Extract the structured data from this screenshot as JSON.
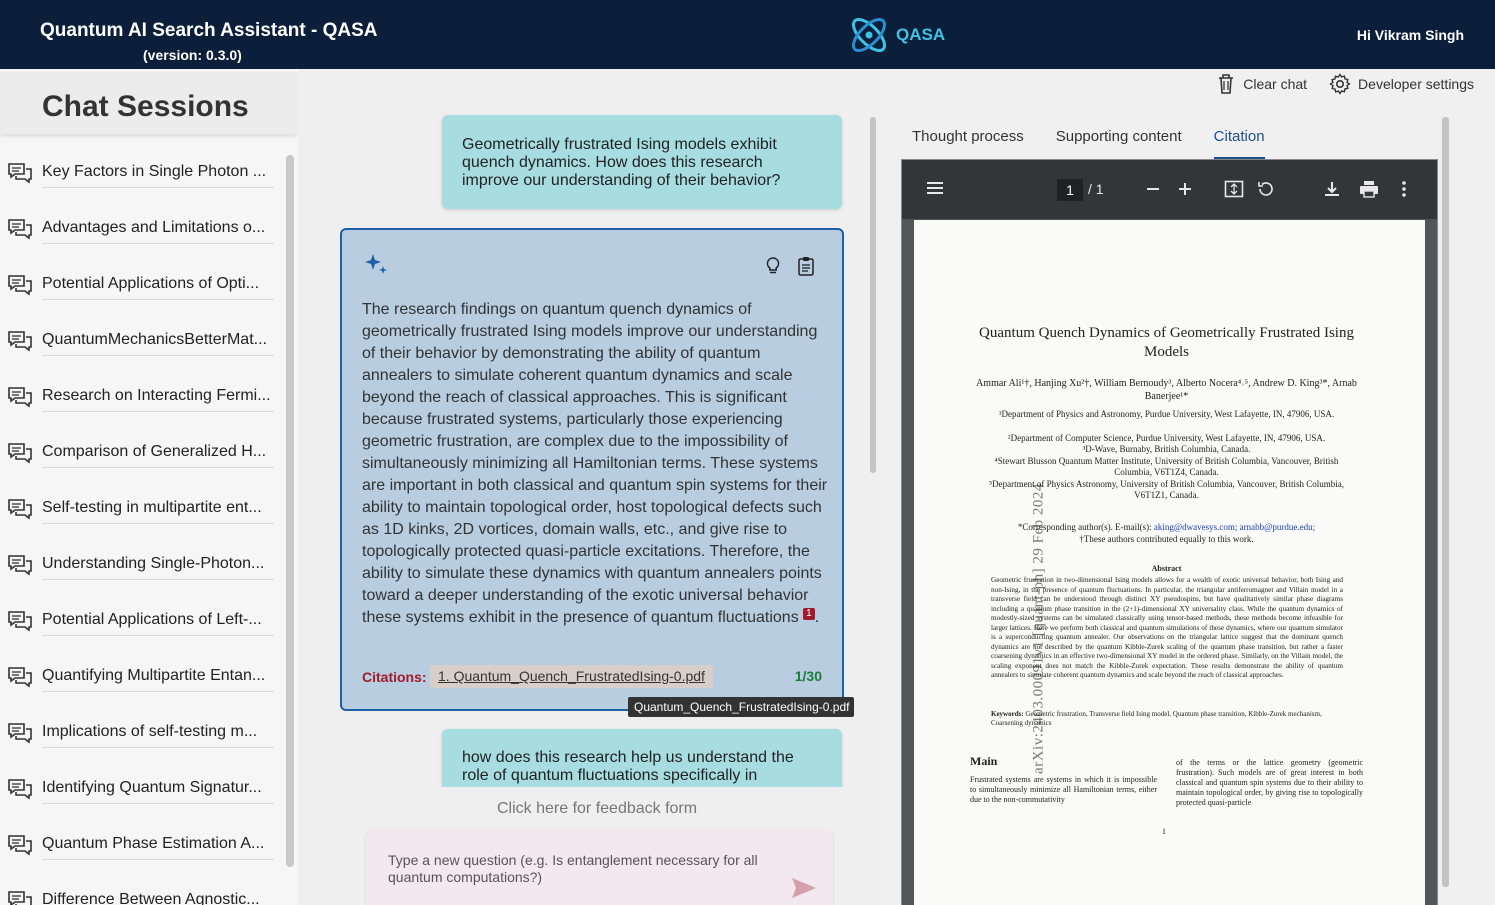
{
  "header": {
    "title": "Quantum AI Search Assistant - QASA",
    "version": "(version: 0.3.0)",
    "logo_text": "QASA",
    "greeting": "Hi Vikram Singh"
  },
  "sidebar": {
    "heading": "Chat Sessions",
    "sessions": [
      "Key Factors in Single Photon ...",
      "Advantages and Limitations o...",
      "Potential Applications of Opti...",
      "QuantumMechanicsBetterMat...",
      "Research on Interacting Fermi...",
      "Comparison of Generalized H...",
      "Self-testing in multipartite ent...",
      "Understanding Single-Photon...",
      "Potential Applications of Left-...",
      "Quantifying Multipartite Entan...",
      "Implications of self-testing m...",
      "Identifying Quantum Signatur...",
      "Quantum Phase Estimation A...",
      "Difference Between Agnostic..."
    ]
  },
  "chat": {
    "user_msg_1": "Geometrically frustrated Ising models exhibit quench dynamics. How does this research improve our understanding of their behavior?",
    "answer_text": "The research findings on quantum quench dynamics of geometrically frustrated Ising models improve our understanding of their behavior by demonstrating the ability of quantum annealers to simulate coherent quantum dynamics and scale beyond the reach of classical approaches. This is significant because frustrated systems, particularly those experiencing geometric frustration, are complex due to the impossibility of simultaneously minimizing all Hamiltonian terms. These systems are important in both classical and quantum spin systems for their ability to maintain topological order, host topological defects such as 1D kinks, 2D vortices, domain walls, etc., and give rise to topologically protected quasi-particle excitations. Therefore, the ability to simulate these dynamics with quantum annealers points toward a deeper understanding of the exotic universal behavior these systems exhibit in the presence of quantum fluctuations",
    "citation_marker": "1",
    "answer_end": ".",
    "citations_label": "Citations:",
    "citation_1": "1. Quantum_Quench_FrustratedIsing-0.pdf",
    "answer_count": "1/30",
    "tooltip": "Quantum_Quench_FrustratedIsing-0.pdf",
    "user_msg_2": "how does this research help us understand the role of quantum fluctuations specifically in",
    "feedback": "Click here for feedback form",
    "input_placeholder": "Type a new question (e.g. Is entanglement necessary for all quantum computations?)"
  },
  "right_panel": {
    "clear_chat": "Clear chat",
    "developer_settings": "Developer settings",
    "tabs": [
      "Thought process",
      "Supporting content",
      "Citation"
    ],
    "active_tab": "Citation",
    "pdf": {
      "page_current": "1",
      "page_total": "/ 1",
      "arxiv_stamp": "arXiv:2403.00091v1  [quant-ph]  29 Feb 2024",
      "title": "Quantum Quench Dynamics of Geometrically Frustrated Ising Models",
      "authors": "Ammar Ali¹†, Hanjing Xu²†, William Bernoudy³, Alberto Nocera⁴˒⁵, Andrew D. King³*, Arnab Banerjee¹*",
      "affil_1": "¹Department of Physics and Astronomy, Purdue University, West Lafayette, IN, 47906, USA.",
      "affil_2": "²Department of Computer Science, Purdue University, West Lafayette, IN, 47906, USA.",
      "affil_3": "³D-Wave, Burnaby, British Columbia, Canada.",
      "affil_4": "⁴Stewart Blusson Quantum Matter Institute, University of British Columbia, Vancouver, British Columbia, V6T1Z4, Canada.",
      "affil_5": "⁵Department of Physics Astronomy, University of British Columbia, Vancouver, British Columbia, V6T1Z1, Canada.",
      "corr_prefix": "*Corresponding author(s). E-mail(s):",
      "corr_emails": "aking@dwavesys.com; arnabb@purdue.edu;",
      "corr_equal": "†These authors contributed equally to this work.",
      "abstract_head": "Abstract",
      "abstract": "Geometric frustration in two-dimensional Ising models allows for a wealth of exotic universal behavior, both Ising and non-Ising, in the presence of quantum fluctuations. In particular, the triangular antiferromagnet and Villain model in a transverse field can be understood through distinct XY pseudospins, but have qualitatively similar phase diagrams including a quantum phase transition in the (2+1)-dimensional XY universality class. While the quantum dynamics of modestly-sized systems can be simulated classically using tensor-based methods, these methods become infeasible for larger lattices. Here we perform both classical and quantum simulations of these dynamics, where our quantum simulator is a superconducting quantum annealer. Our observations on the triangular lattice suggest that the dominant quench dynamics are not described by the quantum Kibble-Zurek scaling of the quantum phase transition, but rather a faster coarsening dynamics in an effective two-dimensional XY model in the ordered phase. Similarly, on the Villain model, the scaling exponent does not match the Kibble-Zurek expectation. These results demonstrate the ability of quantum annealers to simulate coherent quantum dynamics and scale beyond the reach of classical approaches.",
      "keywords_label": "Keywords:",
      "keywords": "Geometric frustration, Transverse field Ising model, Quantum phase transition, Kibble-Zurek mechanism, Coarsening dynamics",
      "main_head": "Main",
      "col_left": "Frustrated systems are systems in which it is impossible to simultaneously minimize all Hamiltonian terms, either due to the non-commutativity",
      "col_right": "of the terms or the lattice geometry (geometric frustration). Such models are of great interest in both classical and quantum spin systems due to their ability to maintain topological order, by giving rise to topologically protected quasi-particle",
      "page_number": "1"
    }
  }
}
